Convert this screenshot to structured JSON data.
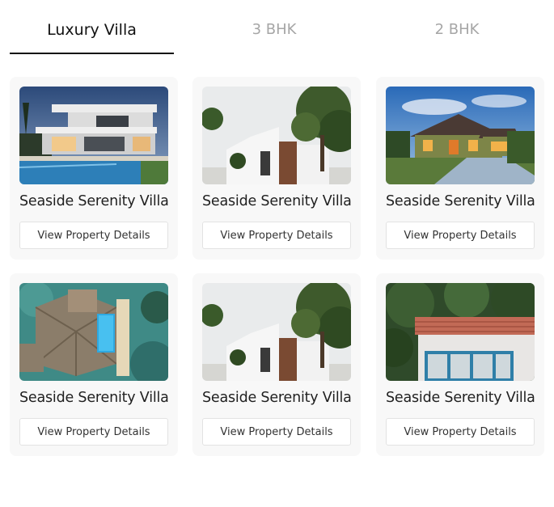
{
  "tabs": [
    {
      "label": "Luxury Villa",
      "active": true
    },
    {
      "label": "3 BHK",
      "active": false
    },
    {
      "label": "2 BHK",
      "active": false
    }
  ],
  "colors": {
    "active_tab": "#111111",
    "inactive_tab": "#a6a6a6",
    "card_bg": "#f8f8f8"
  },
  "properties": [
    {
      "title": "Seaside Serenity Villa",
      "button": "View Property Details",
      "image": "modern-villa-with-pool"
    },
    {
      "title": "Seaside Serenity Villa",
      "button": "View Property Details",
      "image": "white-modern-house-with-tree"
    },
    {
      "title": "Seaside Serenity Villa",
      "button": "View Property Details",
      "image": "suburban-house-at-dusk"
    },
    {
      "title": "Seaside Serenity Villa",
      "button": "View Property Details",
      "image": "aerial-villa-with-pool"
    },
    {
      "title": "Seaside Serenity Villa",
      "button": "View Property Details",
      "image": "white-modern-house-with-tree"
    },
    {
      "title": "Seaside Serenity Villa",
      "button": "View Property Details",
      "image": "cottage-with-tiled-roof"
    }
  ]
}
